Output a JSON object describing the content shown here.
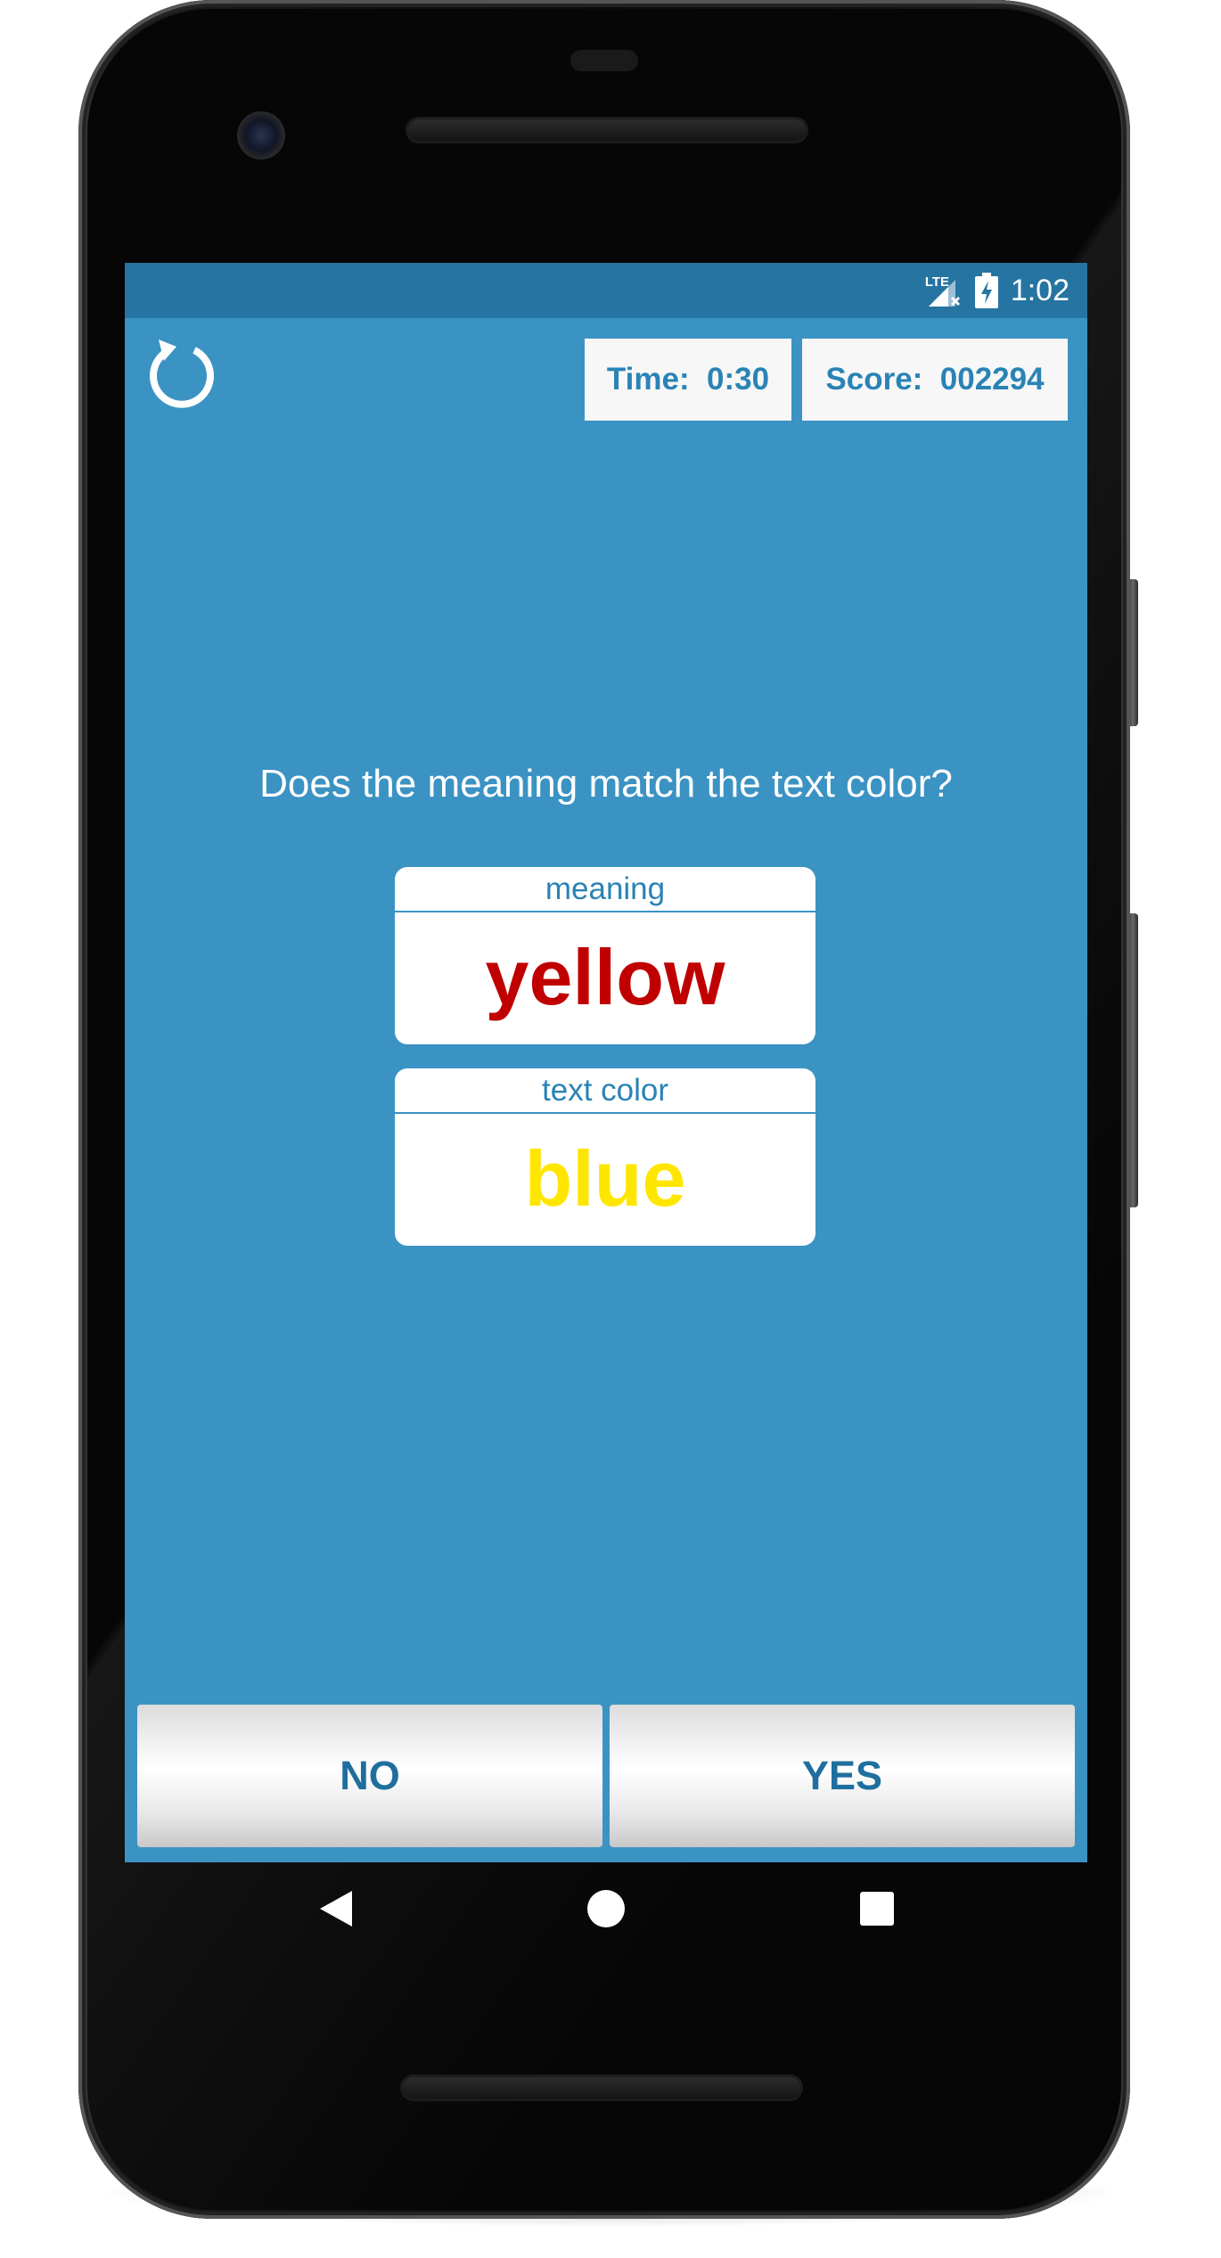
{
  "status_bar": {
    "network_label": "LTE",
    "clock": "1:02"
  },
  "header": {
    "time_text": "Time:  0:30",
    "score_text": "Score:  002294"
  },
  "question": "Does the meaning match the text color?",
  "cards": {
    "meaning": {
      "label": "meaning",
      "word": "yellow",
      "word_color": "#c00000"
    },
    "text_color": {
      "label": "text color",
      "word": "blue",
      "word_color": "#ffe600"
    }
  },
  "answers": {
    "no_label": "NO",
    "yes_label": "YES"
  },
  "colors": {
    "screen_background": "#3b93c3",
    "status_bar": "#2674a1",
    "accent_text": "#2a83b5"
  },
  "icons": {
    "refresh": "refresh-icon",
    "signal": "signal-icon",
    "battery": "battery-charging-icon",
    "back": "back-triangle-icon",
    "home": "home-circle-icon",
    "recents": "recents-square-icon"
  }
}
